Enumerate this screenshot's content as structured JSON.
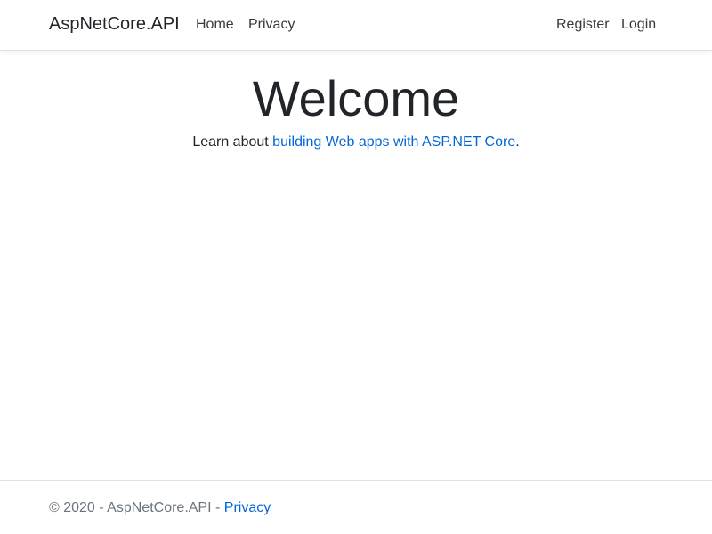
{
  "header": {
    "brand": "AspNetCore.API",
    "nav": {
      "home": "Home",
      "privacy": "Privacy"
    },
    "auth": {
      "register": "Register",
      "login": "Login"
    }
  },
  "main": {
    "title": "Welcome",
    "intro_prefix": "Learn about ",
    "intro_link": "building Web apps with ASP.NET Core",
    "intro_suffix": "."
  },
  "footer": {
    "copyright": "© 2020 - AspNetCore.API - ",
    "privacy_link": "Privacy"
  },
  "colors": {
    "link": "#0366d6",
    "muted": "#6c757d",
    "text": "#212529",
    "border": "#dee2e6"
  }
}
